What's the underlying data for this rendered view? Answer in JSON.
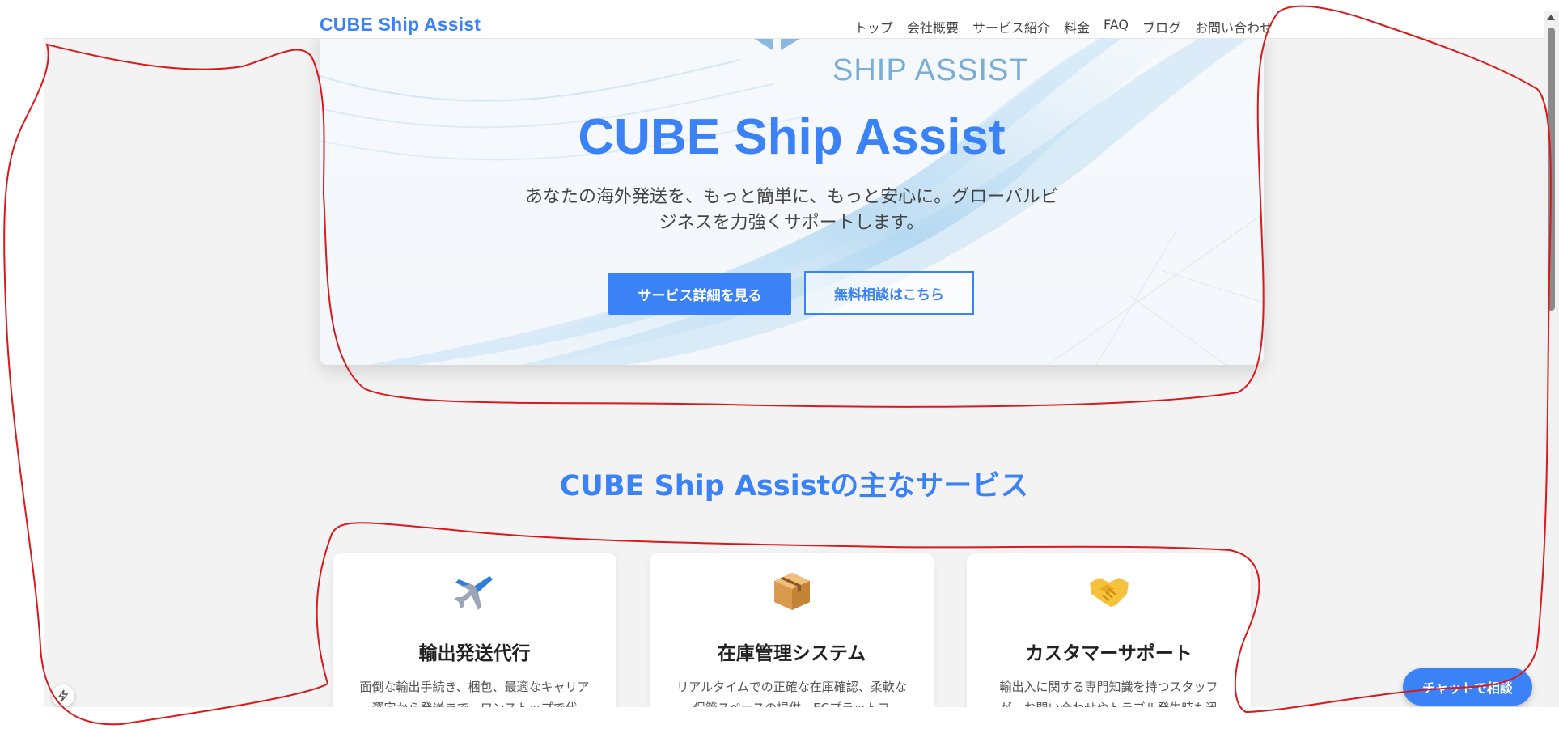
{
  "navbar": {
    "brand": "CUBE Ship Assist",
    "items": [
      "トップ",
      "会社概要",
      "サービス紹介",
      "料金",
      "FAQ",
      "ブログ",
      "お問い合わせ"
    ]
  },
  "hero": {
    "logo_text": "SHIP ASSIST",
    "title": "CUBE Ship Assist",
    "subtitle": "あなたの海外発送を、もっと簡単に、もっと安心に。グローバルビジネスを力強くサポートします。",
    "primary_button": "サービス詳細を見る",
    "secondary_button": "無料相談はこちら"
  },
  "services": {
    "title": "CUBE Ship Assistの主なサービス",
    "cards": [
      {
        "icon": "airplane-icon",
        "title": "輸出発送代行",
        "desc": "面倒な輸出手続き、梱包、最適なキャリア選定から発送まで、ワンストップで代"
      },
      {
        "icon": "package-icon",
        "title": "在庫管理システム",
        "desc": "リアルタイムでの正確な在庫確認、柔軟な保管スペースの提供。ECプラットフ"
      },
      {
        "icon": "handshake-icon",
        "title": "カスタマーサポート",
        "desc": "輸出入に関する専門知識を持つスタッフが、お問い合わせやトラブル発生時も迅"
      }
    ]
  },
  "chat_button": "チャットで相談",
  "colors": {
    "accent": "#3b82f6",
    "annotation": "#d9191c"
  }
}
